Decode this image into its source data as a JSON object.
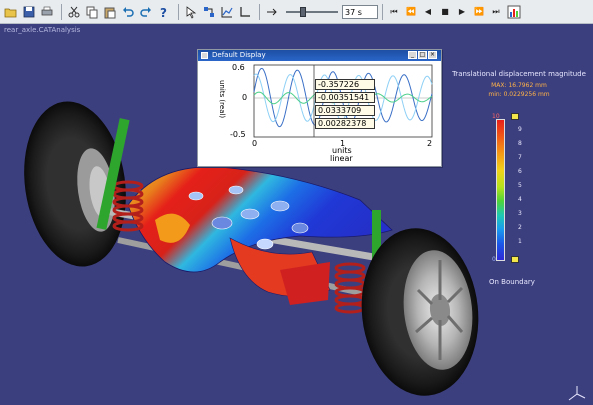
{
  "toolbar": {
    "zoom_value": "37 s",
    "icons": [
      "open-icon",
      "save-icon",
      "print-icon",
      "cut-icon",
      "copy-icon",
      "paste-icon",
      "undo-icon",
      "redo-icon",
      "help-icon",
      "select-icon",
      "analysis-icon",
      "graph-icon"
    ],
    "playback": [
      "rewind-icon",
      "step-back-icon",
      "play-back-icon",
      "stop-icon",
      "play-icon",
      "step-forward-icon",
      "fast-forward-icon",
      "chart-icon"
    ]
  },
  "viewport": {
    "title": "rear_axle.CATAnalysis"
  },
  "graph_window": {
    "title": "Default Display",
    "y_axis_label": "units (real)",
    "x_axis_label": "units",
    "x_axis_scale": "linear",
    "y_ticks": [
      "0.6",
      "0",
      "-0.5"
    ],
    "x_ticks": [
      "0",
      "1",
      "2"
    ],
    "readouts": [
      "-0.357226",
      "-0.00351541",
      "0.0333709",
      "0.00282378"
    ]
  },
  "legend": {
    "title": "Translational displacement magnitude",
    "max": "MAX: 16.7962 mm",
    "min": "min: 0.0229256 mm",
    "top_label": "10",
    "bottom_label": "0",
    "numbers": [
      "9",
      "8",
      "7",
      "6",
      "5",
      "4",
      "3",
      "2",
      "1"
    ],
    "on_boundary": "On Boundary"
  },
  "colors": {
    "viewport_bg": "#3c3f7e",
    "titlebar": "#1d4fa3",
    "accent": "#f2e64b"
  }
}
